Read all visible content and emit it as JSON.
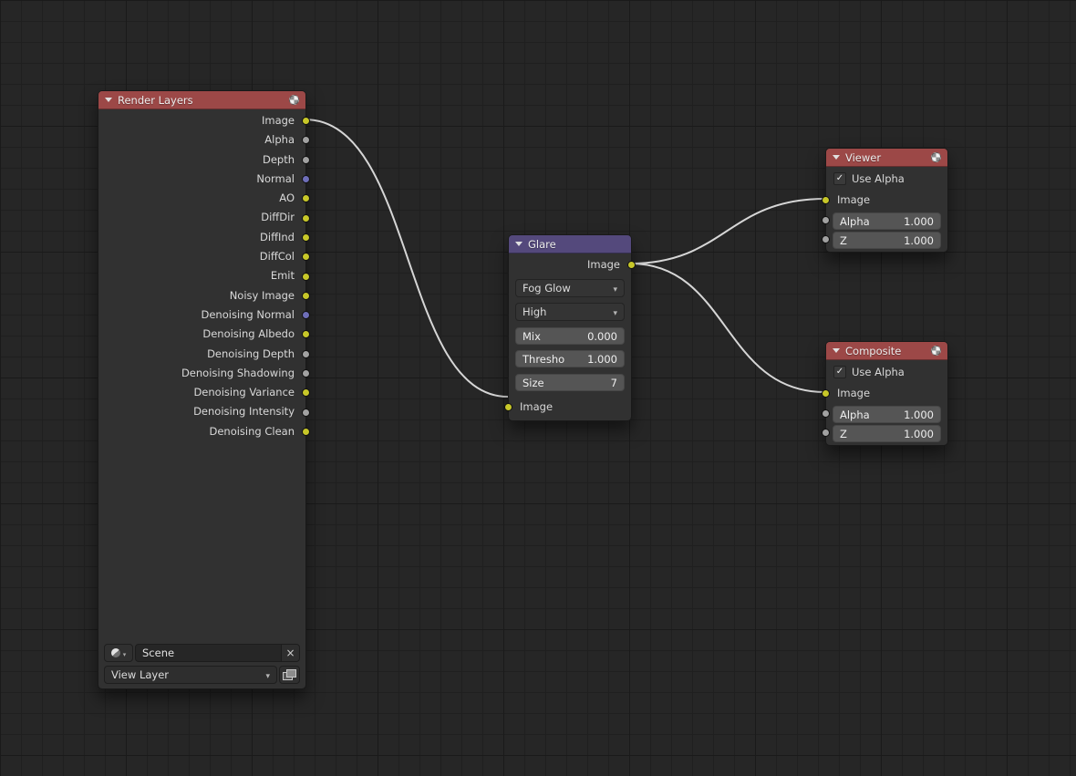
{
  "theme": {
    "canvas_bg": "#262626",
    "grid_line": "#1f1f1f",
    "grid_major": "#1a1a1a",
    "header_red": "#9c4847",
    "header_blue": "#54497c",
    "socket_image": "#c7c729",
    "socket_value": "#a1a1a1",
    "socket_vector": "#6e6eb8",
    "wire_color": "#d6d6d6"
  },
  "nodes": {
    "render_layers": {
      "title": "Render Layers",
      "outputs": [
        {
          "label": "Image"
        },
        {
          "label": "Alpha"
        },
        {
          "label": "Depth"
        },
        {
          "label": "Normal"
        },
        {
          "label": "AO"
        },
        {
          "label": "DiffDir"
        },
        {
          "label": "DiffInd"
        },
        {
          "label": "DiffCol"
        },
        {
          "label": "Emit"
        },
        {
          "label": "Noisy Image"
        },
        {
          "label": "Denoising Normal"
        },
        {
          "label": "Denoising Albedo"
        },
        {
          "label": "Denoising Depth"
        },
        {
          "label": "Denoising Shadowing"
        },
        {
          "label": "Denoising Variance"
        },
        {
          "label": "Denoising Intensity"
        },
        {
          "label": "Denoising Clean"
        }
      ],
      "scene_value": "Scene",
      "view_layer_value": "View Layer"
    },
    "glare": {
      "title": "Glare",
      "output_label": "Image",
      "glare_type": "Fog Glow",
      "quality": "High",
      "mix_label": "Mix",
      "mix_value": "0.000",
      "threshold_label": "Thresho",
      "threshold_value": "1.000",
      "size_label": "Size",
      "size_value": "7",
      "input_label": "Image"
    },
    "viewer": {
      "title": "Viewer",
      "use_alpha_label": "Use Alpha",
      "image_label": "Image",
      "alpha_label": "Alpha",
      "alpha_value": "1.000",
      "z_label": "Z",
      "z_value": "1.000"
    },
    "composite": {
      "title": "Composite",
      "use_alpha_label": "Use Alpha",
      "image_label": "Image",
      "alpha_label": "Alpha",
      "alpha_value": "1.000",
      "z_label": "Z",
      "z_value": "1.000"
    }
  }
}
